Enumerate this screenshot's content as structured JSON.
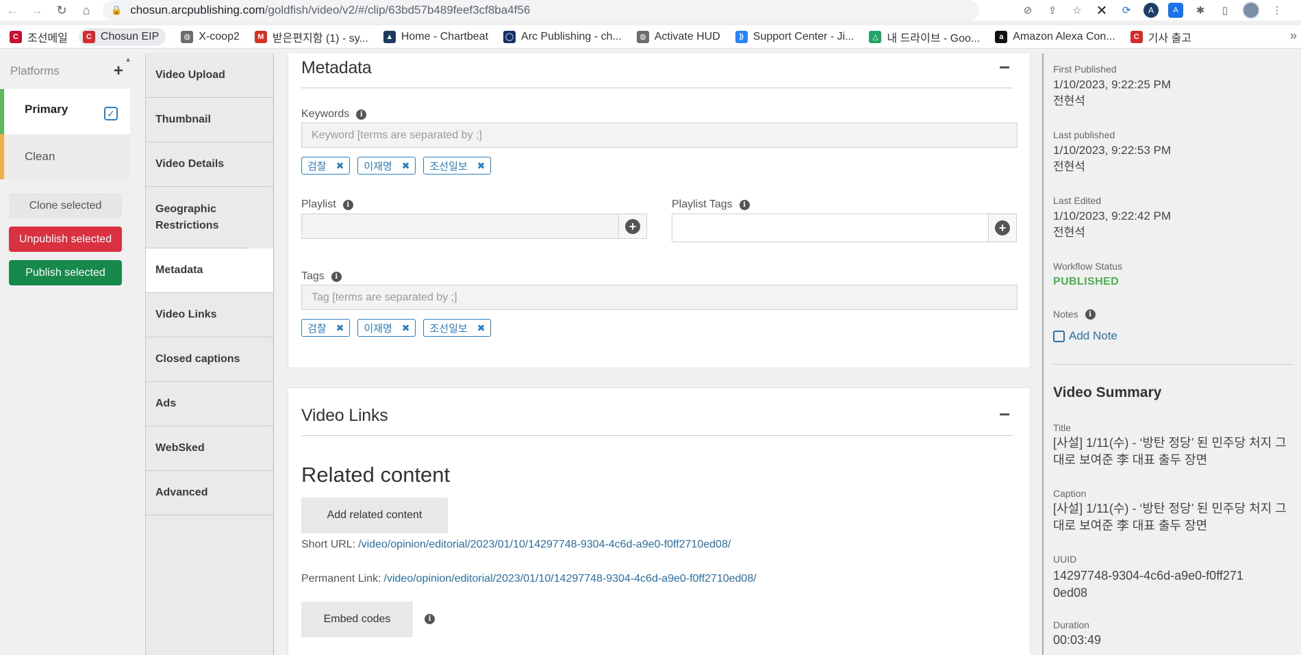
{
  "browser": {
    "url_host": "chosun.arcpublishing.com",
    "url_path": "/goldfish/video/v2/#/clip/63bd57b489feef3cf8ba4f56",
    "bookmarks": [
      {
        "label": "조선메일",
        "icon": "chosun-mail-icon",
        "color": "#c8102e"
      },
      {
        "label": "Chosun EIP",
        "icon": "chosun-eip-icon",
        "color": "#d62b2b"
      },
      {
        "label": "X-coop2",
        "icon": "globe-icon",
        "color": "#6b6b6b"
      },
      {
        "label": "받은편지함 (1) - sy...",
        "icon": "gmail-icon",
        "color": "#d93025"
      },
      {
        "label": "Home - Chartbeat",
        "icon": "chartbeat-icon",
        "color": "#1f3a5f"
      },
      {
        "label": "Arc Publishing - ch...",
        "icon": "arc-icon",
        "color": "#14306b"
      },
      {
        "label": "Activate HUD",
        "icon": "globe-icon",
        "color": "#6b6b6b"
      },
      {
        "label": "Support Center - Ji...",
        "icon": "jira-icon",
        "color": "#2684ff"
      },
      {
        "label": "내 드라이브 - Goo...",
        "icon": "google-drive-icon",
        "color": "#1fa463"
      },
      {
        "label": "Amazon Alexa Con...",
        "icon": "amazon-icon",
        "color": "#111111"
      },
      {
        "label": "기사 출고",
        "icon": "chosun-eip-icon",
        "color": "#d62b2b"
      }
    ]
  },
  "platforms": {
    "header": "Platforms",
    "items": [
      {
        "label": "Primary",
        "checked": true
      },
      {
        "label": "Clean",
        "checked": false
      }
    ],
    "clone_label": "Clone selected",
    "unpublish_label": "Unpublish selected",
    "publish_label": "Publish selected"
  },
  "sections": [
    "Video Upload",
    "Thumbnail",
    "Video Details",
    "Geographic Restrictions",
    "Metadata",
    "Video Links",
    "Closed captions",
    "Ads",
    "WebSked",
    "Advanced"
  ],
  "active_section": "Metadata",
  "metadata": {
    "title": "Metadata",
    "keywords_label": "Keywords",
    "keywords_placeholder": "Keyword [terms are separated by ;]",
    "keywords": [
      "검찰",
      "이재명",
      "조선일보"
    ],
    "playlist_label": "Playlist",
    "playlist_tags_label": "Playlist Tags",
    "tags_label": "Tags",
    "tags_placeholder": "Tag [terms are separated by ;]",
    "tags": [
      "검찰",
      "이재명",
      "조선일보"
    ]
  },
  "video_links": {
    "title": "Video Links",
    "related_heading": "Related content",
    "add_related_label": "Add related content",
    "short_url_label": "Short URL:",
    "short_url": "/video/opinion/editorial/2023/01/10/14297748-9304-4c6d-a9e0-f0ff2710ed08/",
    "permanent_link_label": "Permanent Link:",
    "permanent_link": "/video/opinion/editorial/2023/01/10/14297748-9304-4c6d-a9e0-f0ff2710ed08/",
    "embed_label": "Embed codes"
  },
  "sidebar": {
    "first_published_label": "First Published",
    "first_published_date": "1/10/2023, 9:22:25 PM",
    "first_published_by": "전현석",
    "last_published_label": "Last published",
    "last_published_date": "1/10/2023, 9:22:53 PM",
    "last_published_by": "전현석",
    "last_edited_label": "Last Edited",
    "last_edited_date": "1/10/2023, 9:22:42 PM",
    "last_edited_by": "전현석",
    "workflow_label": "Workflow Status",
    "workflow_value": "PUBLISHED",
    "notes_label": "Notes",
    "add_note_label": "Add Note",
    "summary_title": "Video Summary",
    "title_label": "Title",
    "title_value": "[사설] 1/11(수) - ‘방탄 정당’ 된 민주당 처지 그대로 보여준 李 대표 출두 장면",
    "caption_label": "Caption",
    "caption_value": "[사설] 1/11(수) - ‘방탄 정당’ 된 민주당 처지 그대로 보여준 李 대표 출두 장면",
    "uuid_label": "UUID",
    "uuid_value": "14297748-9304-4c6d-a9e0-f0ff2710ed08",
    "duration_label": "Duration",
    "duration_value": "00:03:49"
  }
}
